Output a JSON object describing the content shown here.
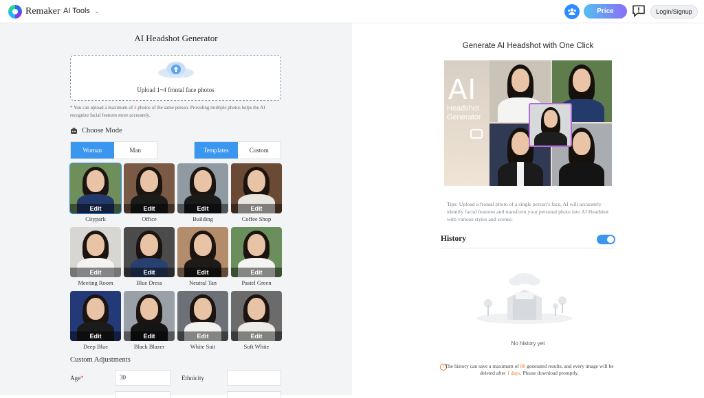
{
  "header": {
    "brand": "Remaker",
    "menu_label": "AI Tools",
    "price_label": "Price",
    "login_label": "Login/Signup"
  },
  "left": {
    "title": "AI Headshot Generator",
    "upload_text": "Upload 1~4 frontal face photos",
    "note_pre": "* You can upload a maximum of ",
    "note_count": "4",
    "note_post": " photos of the same person. Providing multiple photos helps the AI recognize facial features more accurately.",
    "mode_heading": "Choose Mode",
    "gender_options": [
      "Woman",
      "Man"
    ],
    "source_options": [
      "Templates",
      "Custom"
    ],
    "edit_label": "Edit",
    "templates": [
      {
        "label": "Citypark",
        "bg": "#6f8f5a",
        "body": "#243a6b",
        "selected": true
      },
      {
        "label": "Office",
        "bg": "#7a5a44",
        "body": "#1b1b1b",
        "selected": false
      },
      {
        "label": "Building",
        "bg": "#8f9aa3",
        "body": "#1a1a1a",
        "selected": false
      },
      {
        "label": "Coffee Shop",
        "bg": "#6a4a34",
        "body": "#e9e6e0",
        "selected": false
      },
      {
        "label": "Meeting Room",
        "bg": "#d8d6d2",
        "body": "#f3f3f3",
        "selected": false
      },
      {
        "label": "Blue Dress",
        "bg": "#4b4b4b",
        "body": "#27406f",
        "selected": false
      },
      {
        "label": "Neutral Tan",
        "bg": "#b38d6b",
        "body": "#1d1a17",
        "selected": false
      },
      {
        "label": "Pastel Green",
        "bg": "#6a8f5c",
        "body": "#f4f4f2",
        "selected": false
      },
      {
        "label": "Deep Blue",
        "bg": "#243a78",
        "body": "#1b1b1b",
        "selected": false
      },
      {
        "label": "Black Blazer",
        "bg": "#9aa0a7",
        "body": "#151515",
        "selected": false
      },
      {
        "label": "White Suit",
        "bg": "#6d7177",
        "body": "#f2f2ef",
        "selected": false
      },
      {
        "label": "Soft White",
        "bg": "#6b6b6b",
        "body": "#ecebe7",
        "selected": false
      }
    ],
    "adjust_title": "Custom Adjustments",
    "age_label": "Age",
    "age_required": "*",
    "age_value": "30",
    "ethnicity_label": "Ethnicity"
  },
  "right": {
    "title": "Generate AI Headshot with One Click",
    "collage_ai": "AI",
    "collage_line1": "Headshot",
    "collage_line2": "Generator",
    "tips": "Tips: Upload a frontal photo of a single person's face, AI will accurately identify facial features and transform your personal photo into AI Headshot with various styles and scenes.",
    "history_title": "History",
    "no_history": "No history yet",
    "warn_pre": "The history can save a maximum of ",
    "warn_max": "80",
    "warn_mid": " generated results, and every image will be deleted after ",
    "warn_days": "1 days",
    "warn_post": ". Please download promptly."
  },
  "colors": {
    "accent": "#3b96f0",
    "highlight": "#e8742c"
  },
  "icons": [
    "users-icon",
    "feedback-icon",
    "upload-cloud-icon",
    "mode-icon",
    "camera-icon",
    "warning-icon",
    "chevron-down-icon"
  ]
}
